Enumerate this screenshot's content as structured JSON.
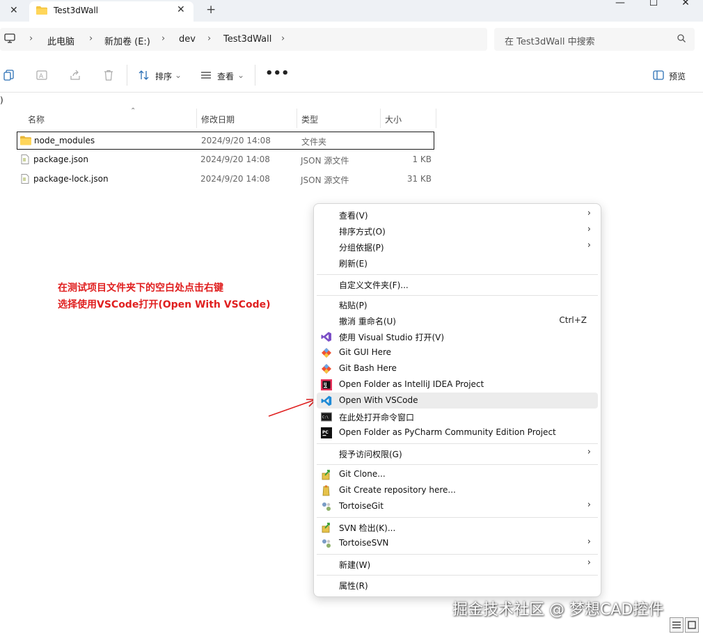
{
  "tabs": {
    "active_title": "Test3dWall",
    "close_glyph": "✕",
    "add_glyph": "+"
  },
  "window": {
    "minimize": "—",
    "maximize": "☐",
    "close": "✕"
  },
  "address": {
    "crumbs": [
      "此电脑",
      "新加卷 (E:)",
      "dev",
      "Test3dWall"
    ],
    "search_placeholder": "在 Test3dWall 中搜索"
  },
  "toolbar": {
    "sort_label": "排序",
    "view_label": "查看",
    "more_label": "•••",
    "preview_label": "预览"
  },
  "path_strip_text": ")",
  "columns": {
    "name": "名称",
    "modified": "修改日期",
    "type": "类型",
    "size": "大小"
  },
  "files": [
    {
      "name": "node_modules",
      "date": "2024/9/20 14:08",
      "type": "文件夹",
      "size": "",
      "icon": "folder-icon"
    },
    {
      "name": "package.json",
      "date": "2024/9/20 14:08",
      "type": "JSON 源文件",
      "size": "1 KB",
      "icon": "file-icon"
    },
    {
      "name": "package-lock.json",
      "date": "2024/9/20 14:08",
      "type": "JSON 源文件",
      "size": "31 KB",
      "icon": "file-icon"
    }
  ],
  "annotation": {
    "line1": "在测试项目文件夹下的空白处点击右键",
    "line2": "选择使用VSCode打开(Open With VSCode)",
    "color": "#e02020"
  },
  "menu": {
    "items": [
      {
        "label": "查看(V)",
        "submenu": true
      },
      {
        "label": "排序方式(O)",
        "submenu": true
      },
      {
        "label": "分组依据(P)",
        "submenu": true
      },
      {
        "label": "刷新(E)"
      },
      {
        "label": "自定义文件夹(F)..."
      },
      {
        "label": "粘贴(P)"
      },
      {
        "label": "撤消 重命名(U)",
        "shortcut": "Ctrl+Z"
      },
      {
        "label": "使用 Visual Studio 打开(V)",
        "icon": "visual-studio-icon"
      },
      {
        "label": "Git GUI Here",
        "icon": "git-gui-icon"
      },
      {
        "label": "Git Bash Here",
        "icon": "git-bash-icon"
      },
      {
        "label": "Open Folder as IntelliJ IDEA Project",
        "icon": "intellij-icon"
      },
      {
        "label": "Open With VSCode",
        "icon": "vscode-icon",
        "highlighted": true
      },
      {
        "label": "在此处打开命令窗口",
        "icon": "cmd-icon"
      },
      {
        "label": "Open Folder as PyCharm Community Edition Project",
        "icon": "pycharm-icon"
      },
      {
        "label": "授予访问权限(G)",
        "submenu": true
      },
      {
        "label": "Git Clone...",
        "icon": "git-clone-icon"
      },
      {
        "label": "Git Create repository here...",
        "icon": "git-create-icon"
      },
      {
        "label": "TortoiseGit",
        "icon": "tortoisegit-icon",
        "submenu": true
      },
      {
        "label": "SVN 检出(K)...",
        "icon": "svn-checkout-icon"
      },
      {
        "label": "TortoiseSVN",
        "icon": "tortoisesvn-icon",
        "submenu": true
      },
      {
        "label": "新建(W)",
        "submenu": true
      },
      {
        "label": "属性(R)"
      }
    ],
    "submenu_glyph": "›"
  },
  "watermark": "掘金技术社区 @ 梦想CAD控件"
}
